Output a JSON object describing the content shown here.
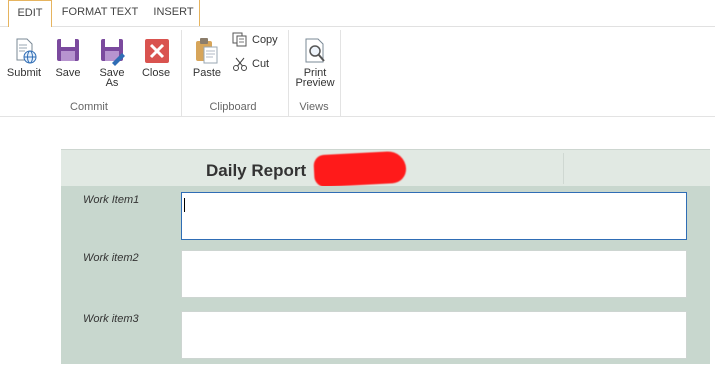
{
  "tabs": [
    {
      "label": "EDIT",
      "active": true
    },
    {
      "label": "FORMAT TEXT",
      "active": false
    },
    {
      "label": "INSERT",
      "active": false
    }
  ],
  "ribbon": {
    "commit": {
      "group_label": "Commit",
      "submit": {
        "label": "Submit",
        "icon": "submit-globe-icon"
      },
      "save": {
        "label": "Save",
        "icon": "floppy-disk-icon"
      },
      "save_as": {
        "label_line1": "Save",
        "label_line2": "As",
        "icon": "floppy-disk-pencil-icon"
      },
      "close": {
        "label": "Close",
        "icon": "close-x-icon"
      }
    },
    "clipboard": {
      "group_label": "Clipboard",
      "paste": {
        "label": "Paste",
        "icon": "clipboard-paste-icon"
      },
      "copy": {
        "label": "Copy",
        "icon": "copy-icon"
      },
      "cut": {
        "label": "Cut",
        "icon": "scissors-icon"
      }
    },
    "views": {
      "group_label": "Views",
      "print_preview": {
        "label_line1": "Print",
        "label_line2": "Preview",
        "icon": "magnifier-page-icon"
      }
    }
  },
  "form": {
    "title": "Daily Report",
    "fields": [
      {
        "label": "Work Item1",
        "value": ""
      },
      {
        "label": "Work item2",
        "value": ""
      },
      {
        "label": "Work item3",
        "value": ""
      }
    ]
  },
  "colors": {
    "tab_accent": "#e6b45f",
    "form_header_bg": "#e1e9e3",
    "form_body_bg": "#c8d7ce",
    "save_purple": "#7b4a9e",
    "close_red": "#d9534f",
    "focus_blue": "#2f6db5"
  }
}
